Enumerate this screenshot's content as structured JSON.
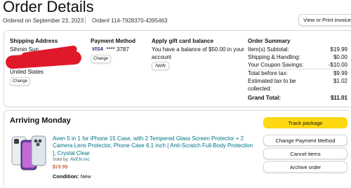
{
  "page": {
    "title": "Order Details"
  },
  "order_meta": {
    "ordered_on": "Ordered on September 23, 2023",
    "order_number": "Order# 114-7928370-4395463",
    "view_invoice": "View or Print invoice"
  },
  "shipping": {
    "heading": "Shipping Address",
    "name": "Sihmin Sun",
    "country": "United States",
    "change": "Change"
  },
  "payment": {
    "heading": "Payment Method",
    "card_brand": "VISA",
    "card_last4": "**** 3787",
    "change": "Change"
  },
  "gift_card": {
    "heading": "Apply gift card balance",
    "line1": "You have a balance of $50.00 in your",
    "line2": "account",
    "apply": "Apply"
  },
  "summary": {
    "heading": "Order Summary",
    "rows": [
      {
        "label": "Item(s) Subtotal:",
        "value": "$19.99"
      },
      {
        "label": "Shipping & Handling:",
        "value": "$0.00"
      },
      {
        "label": "Your Coupon Savings:",
        "value": "-$10.00"
      },
      {
        "label": "Total before tax:",
        "value": "$9.99"
      },
      {
        "label": "Estimated tax to be",
        "value": "$1.02"
      },
      {
        "label": "collected:",
        "value": ""
      }
    ],
    "grand_label": "Grand Total:",
    "grand_value": "$11.01"
  },
  "shipment": {
    "heading": "Arriving Monday",
    "product": {
      "title": "Aven 5 in 1 for iPhone 15 Case, with 2 Tempered Glass Screen Protector + 2 Camera Lens Protector, Phone Case 6.1 inch [ Anti-Scratch Full-Body Protection ], Crystal Clear",
      "sold_by_label": "Sold by:",
      "sold_by": "AVEN Inc",
      "price": "$19.99",
      "condition_label": "Condition:",
      "condition": "New"
    },
    "actions": {
      "track": "Track package",
      "change_payment": "Change Payment Method",
      "cancel": "Cancel items",
      "archive": "Archive order"
    }
  },
  "colors": {
    "accent_yellow": "#ffd814",
    "link": "#007185",
    "price_red": "#b12704",
    "redaction": "#e0192a"
  }
}
